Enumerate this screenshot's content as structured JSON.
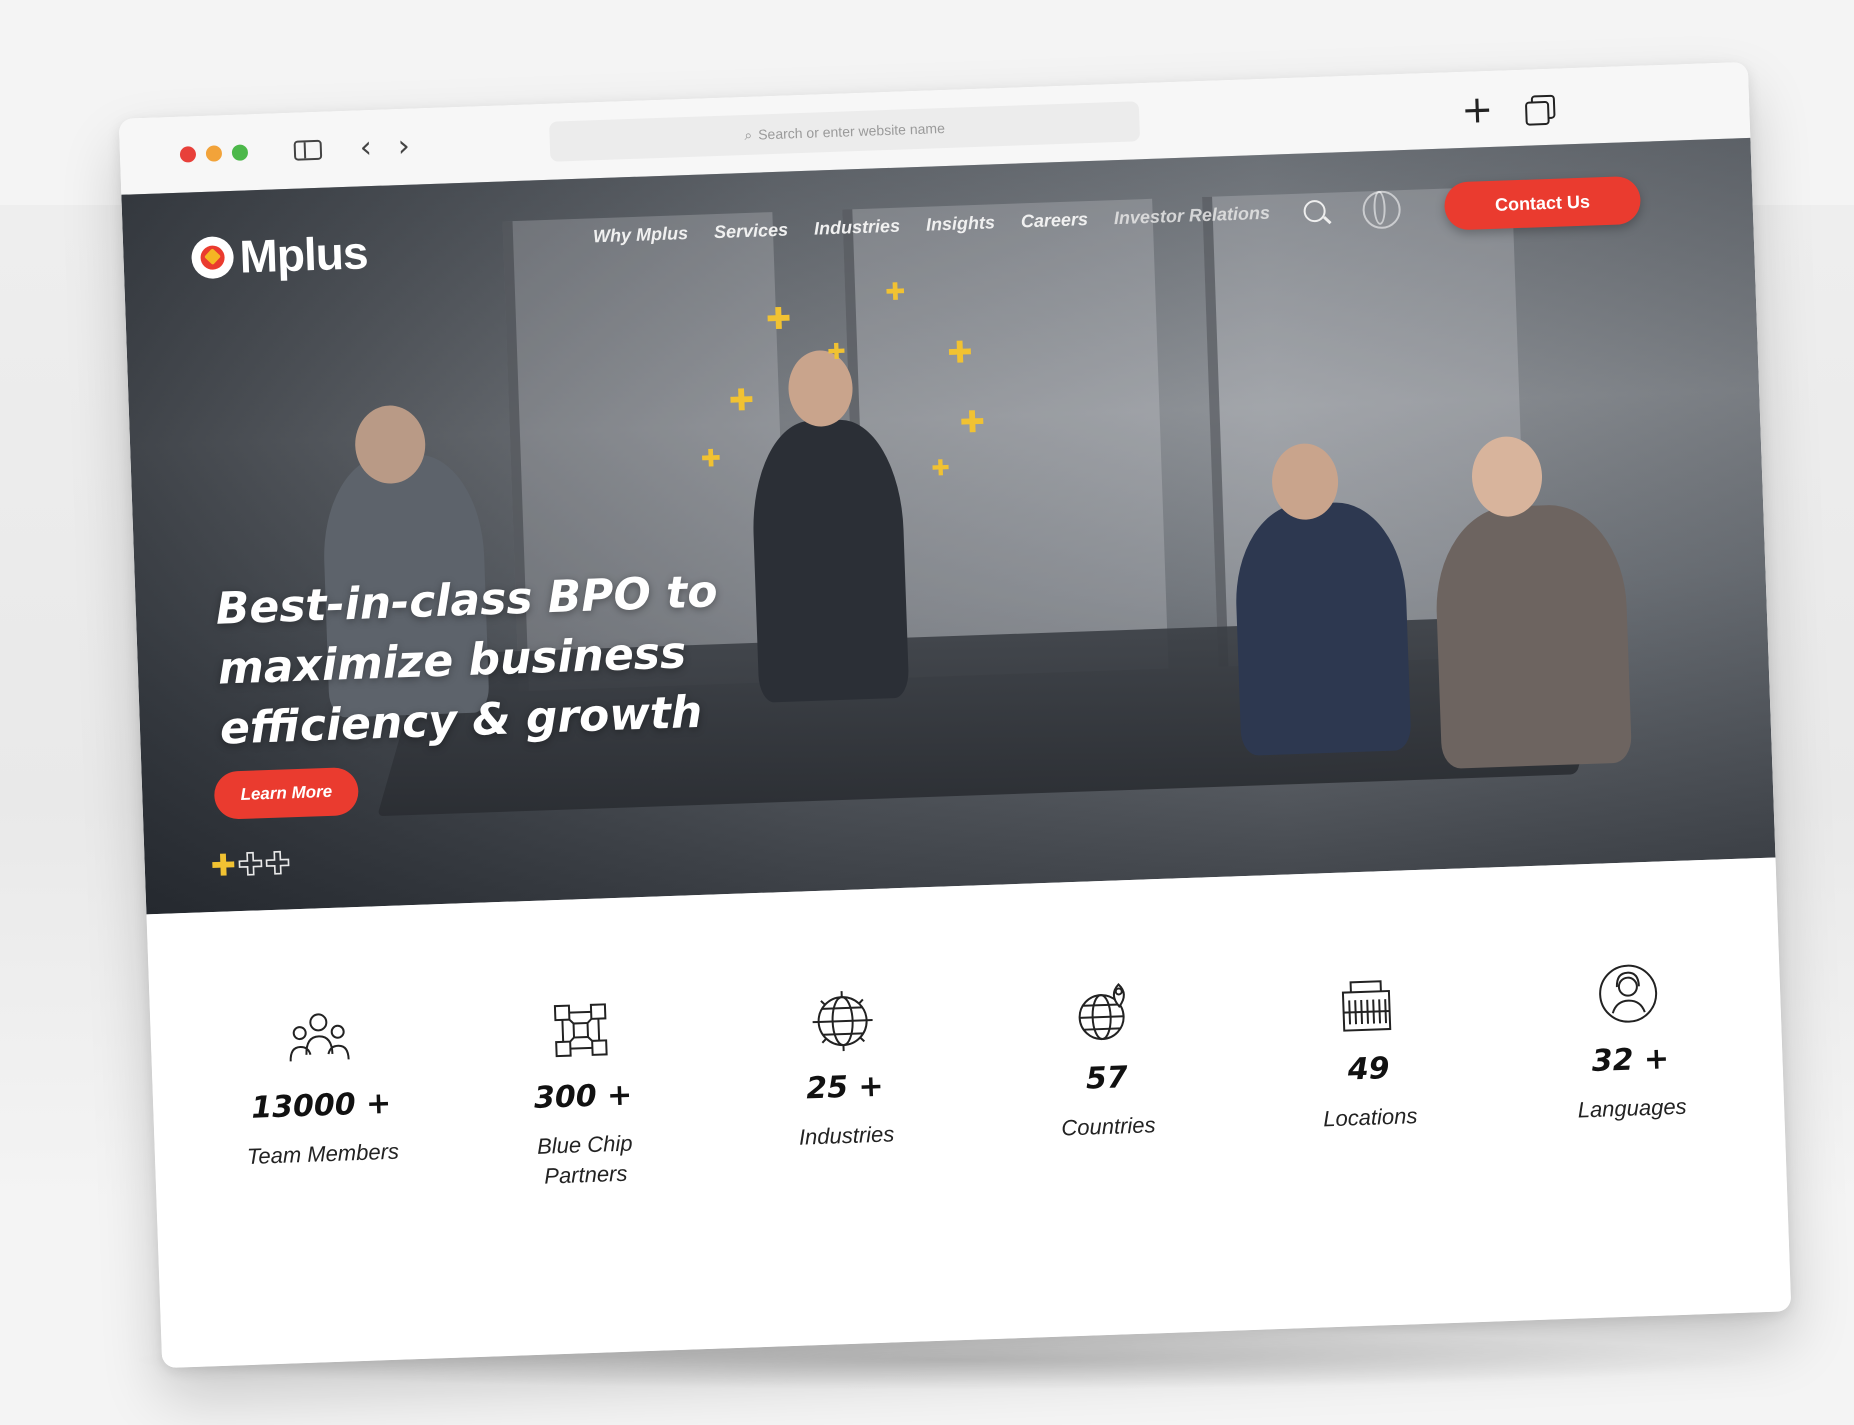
{
  "browser": {
    "address_placeholder": "Search or enter website name"
  },
  "site": {
    "logo_text": "Mplus",
    "nav": [
      {
        "label": "Why Mplus"
      },
      {
        "label": "Services"
      },
      {
        "label": "Industries"
      },
      {
        "label": "Insights"
      },
      {
        "label": "Careers"
      },
      {
        "label": "Investor Relations"
      }
    ],
    "contact_label": "Contact Us"
  },
  "hero": {
    "headline_lines": [
      "Best-in-class BPO to",
      "maximize business",
      "efficiency & growth"
    ],
    "cta_label": "Learn More",
    "slides_total": 3,
    "slide_active": 1
  },
  "stats": [
    {
      "value": "13000 +",
      "label": "Team Members",
      "icon": "team-icon"
    },
    {
      "value": "300 +",
      "label": "Blue Chip Partners",
      "icon": "network-icon"
    },
    {
      "value": "25 +",
      "label": "Industries",
      "icon": "globe-gear-icon"
    },
    {
      "value": "57",
      "label": "Countries",
      "icon": "globe-pin-icon"
    },
    {
      "value": "49",
      "label": "Locations",
      "icon": "building-icon"
    },
    {
      "value": "32 +",
      "label": "Languages",
      "icon": "speaker-person-icon"
    }
  ],
  "colors": {
    "brand_red": "#ea3b2f",
    "accent_yellow": "#f1c232",
    "text_dark": "#111111"
  }
}
